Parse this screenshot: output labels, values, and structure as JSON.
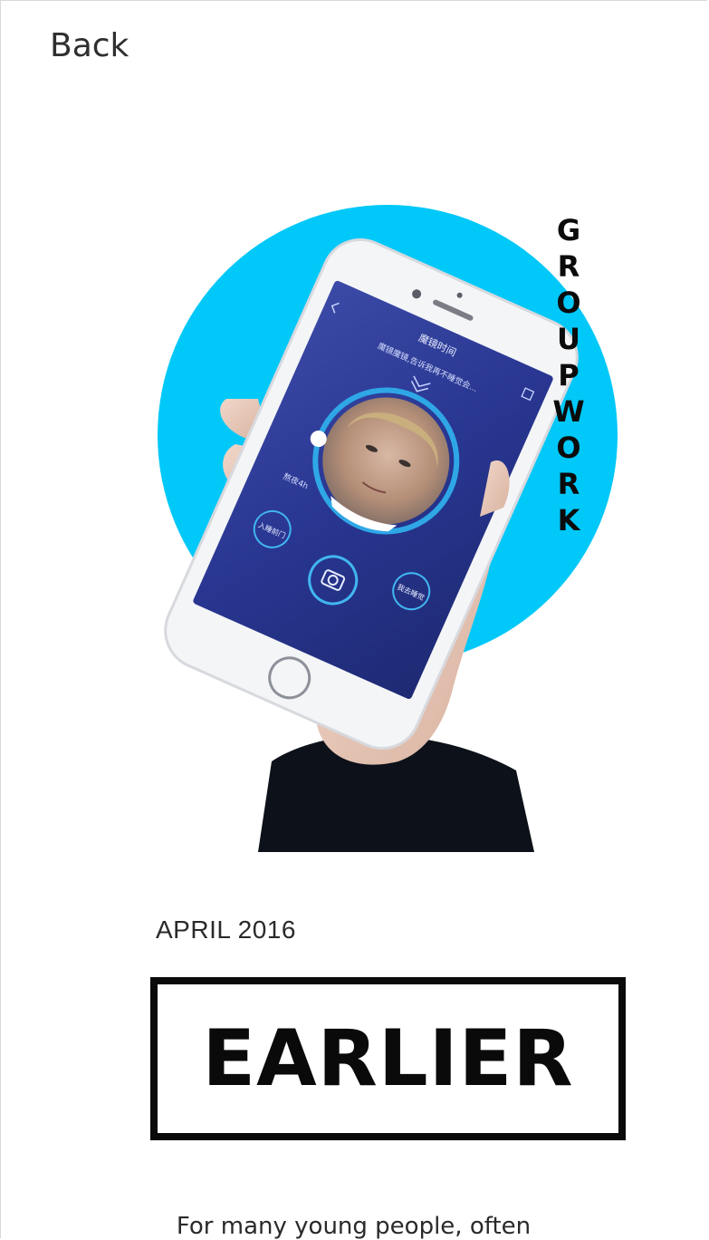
{
  "nav": {
    "back_label": "Back"
  },
  "hero": {
    "vertical_word": [
      "G",
      "R",
      "O",
      "U",
      "P",
      "W",
      "O",
      "R",
      "K"
    ],
    "circle_color": "#00c8f8",
    "phone": {
      "header_title": "魔镜时间",
      "subtitle": "魔镜魔镜,告诉我再不睡觉会...",
      "timer_label": "熬夜4h",
      "left_button": "入睡前门",
      "right_button": "我去睡觉"
    }
  },
  "article": {
    "date": "APRIL 2016",
    "title": "EARLIER",
    "intro": "For many young people, often"
  }
}
